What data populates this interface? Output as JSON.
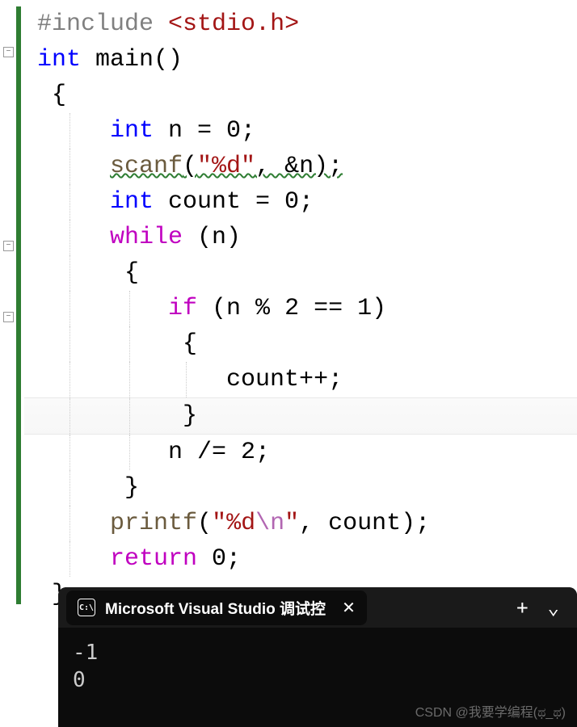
{
  "code": {
    "line1": {
      "preproc": "#include",
      "angle_open": " <",
      "header": "stdio.h",
      "angle_close": ">"
    },
    "line2": {
      "kw1": "int",
      "ident": " main",
      "parens": "()"
    },
    "line3": {
      "brace": " {"
    },
    "line4": {
      "pad": "     ",
      "kw": "int",
      "rest": " n = 0;"
    },
    "line5": {
      "pad": "     ",
      "func": "scanf",
      "open": "(",
      "str": "\"%d\"",
      "rest": ", &n);"
    },
    "line6": {
      "pad": "     ",
      "kw": "int",
      "rest": " count = 0;"
    },
    "line7": {
      "pad": "     ",
      "kw": "while",
      "rest": " (n)"
    },
    "line8": {
      "pad": "     ",
      "brace": " {"
    },
    "line9": {
      "pad": "         ",
      "kw": "if",
      "rest": " (n % 2 == 1)"
    },
    "line10": {
      "pad": "          ",
      "brace": "{"
    },
    "line11": {
      "pad": "             ",
      "text": "count++;"
    },
    "line12": {
      "pad": "          ",
      "brace": "}"
    },
    "line13": {
      "pad": "         ",
      "text": "n /= 2;"
    },
    "line14": {
      "pad": "     ",
      "brace": " }"
    },
    "line15": {
      "pad": "     ",
      "func": "printf",
      "open": "(",
      "str1": "\"%d",
      "esc": "\\n",
      "str2": "\"",
      "rest": ", count);"
    },
    "line16": {
      "pad": "     ",
      "kw": "return",
      "rest": " 0;"
    },
    "line17": {
      "brace": " }"
    }
  },
  "terminal": {
    "icon_text": "C:\\",
    "title": "Microsoft Visual Studio 调试控",
    "close": "✕",
    "plus": "+",
    "chevron": "⌄",
    "out1": "-1",
    "out2": "0"
  },
  "watermark": "CSDN @我要学编程(ಥ_ಥ)"
}
